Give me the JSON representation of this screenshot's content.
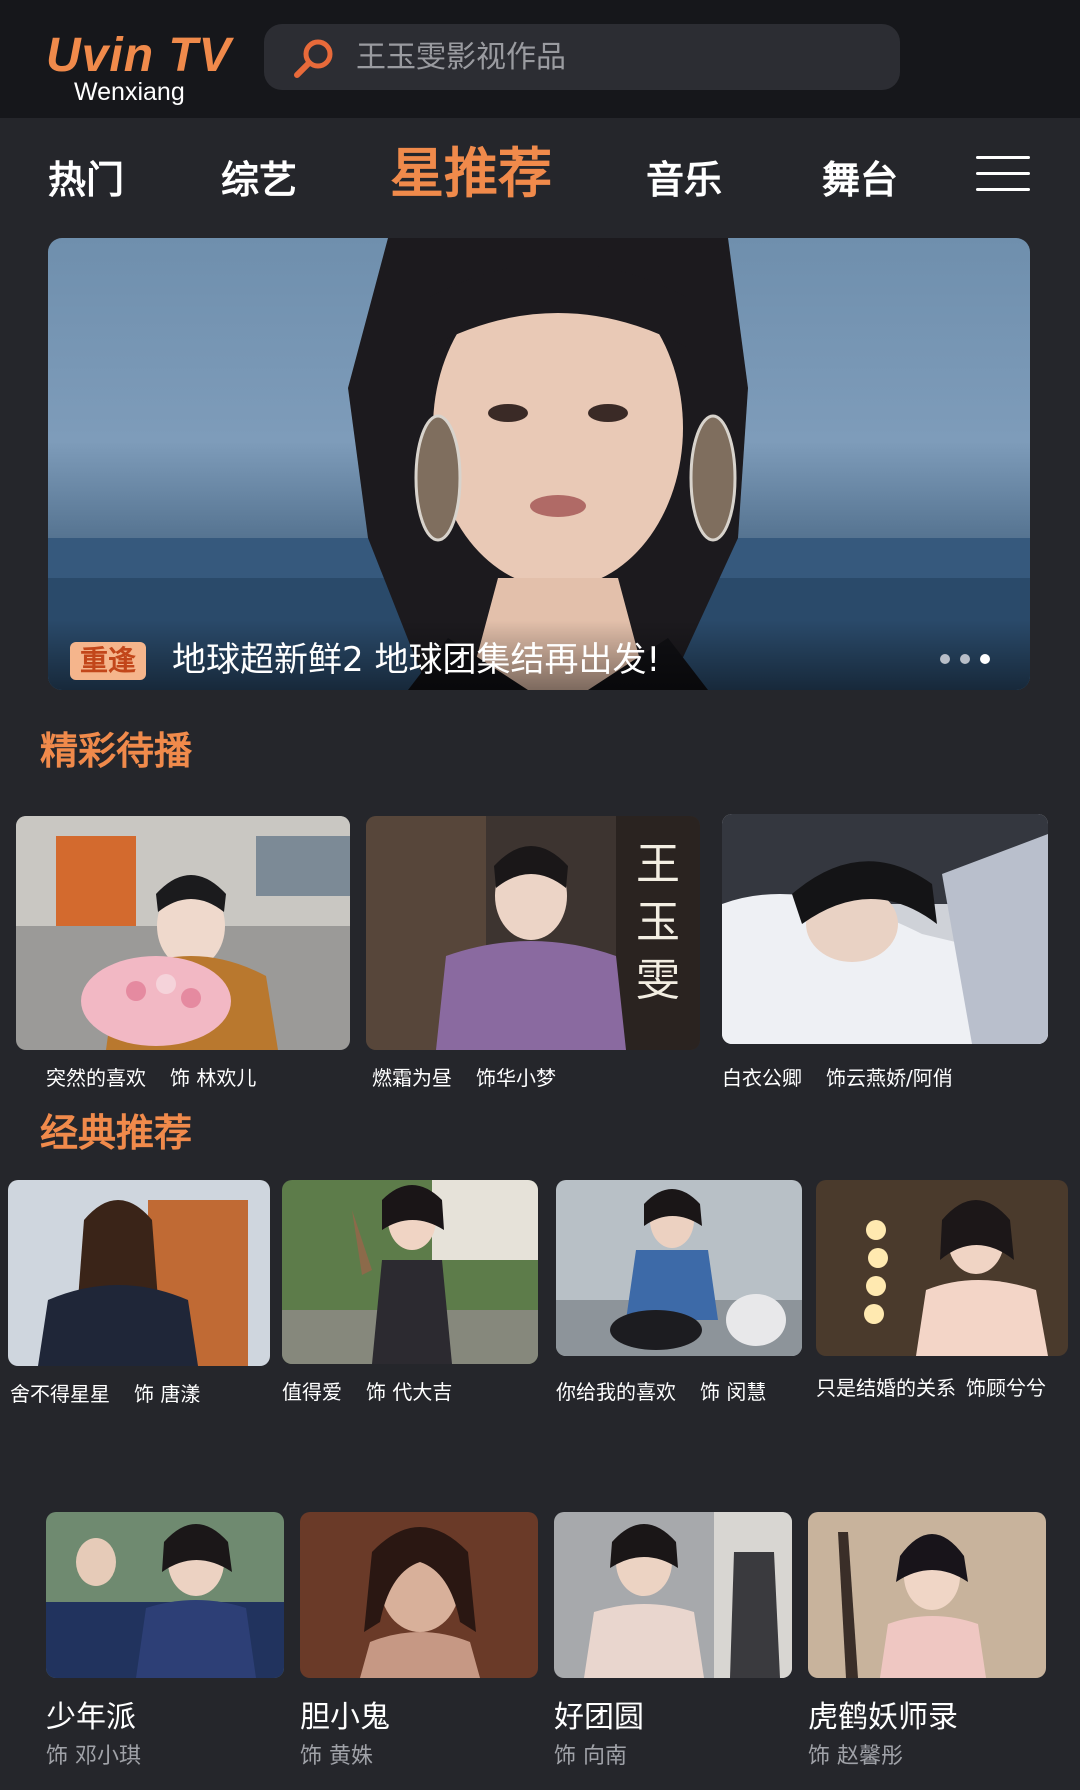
{
  "app": {
    "logo_main": "Uvin TV",
    "logo_sub": "Wenxiang"
  },
  "search": {
    "placeholder": "王玉雯影视作品",
    "icon": "search-icon",
    "icon_color": "#e86a3a"
  },
  "nav": {
    "tabs": [
      {
        "label": "热门",
        "active": false
      },
      {
        "label": "综艺",
        "active": false
      },
      {
        "label": "星推荐",
        "active": true
      },
      {
        "label": "音乐",
        "active": false
      },
      {
        "label": "舞台",
        "active": false
      }
    ],
    "menu_icon": "hamburger-menu-icon"
  },
  "banner": {
    "tag": "重逢",
    "title": "地球超新鲜2 地球团集结再出发!",
    "slides_total": 3,
    "slide_active": 3
  },
  "sections": {
    "upcoming": {
      "title": "精彩待播",
      "items": [
        {
          "show": "突然的喜欢",
          "role": "饰 林欢儿"
        },
        {
          "show": "燃霜为昼",
          "role": "饰华小梦",
          "thumb_text": "王玉雯"
        },
        {
          "show": "白衣公卿",
          "role": "饰云燕娇/阿俏"
        }
      ]
    },
    "classic": {
      "title": "经典推荐",
      "items": [
        {
          "show": "舍不得星星",
          "role": "饰 唐漾"
        },
        {
          "show": "值得爱",
          "role": "饰 代大吉"
        },
        {
          "show": "你给我的喜欢",
          "role": "饰 闵慧"
        },
        {
          "show": "只是结婚的关系",
          "role": "饰顾兮兮"
        }
      ]
    },
    "more": {
      "items": [
        {
          "show": "少年派",
          "role": "饰 邓小琪"
        },
        {
          "show": "胆小鬼",
          "role": "饰 黄姝"
        },
        {
          "show": "好团圆",
          "role": "饰 向南"
        },
        {
          "show": "虎鹤妖师录",
          "role": "饰 赵馨彤"
        }
      ]
    }
  },
  "colors": {
    "accent": "#f08a4b",
    "background": "#25262b",
    "header": "#16171b"
  }
}
